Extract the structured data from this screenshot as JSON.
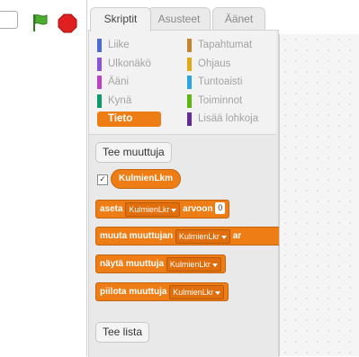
{
  "colors": {
    "motion": "#4a6cd4",
    "looks": "#8a55d7",
    "sound": "#bb42c3",
    "pen": "#0e9a6c",
    "data": "#ee7d16",
    "events": "#c88330",
    "control": "#e1a91a",
    "sensing": "#2ca5e2",
    "operators": "#5cb712",
    "more_blocks": "#632d99"
  },
  "stage": {
    "flag_icon": "green-flag-icon",
    "stop_icon": "stop-icon"
  },
  "tabs": [
    {
      "label": "Skriptit",
      "active": true
    },
    {
      "label": "Asusteet",
      "active": false
    },
    {
      "label": "Äänet",
      "active": false
    }
  ],
  "categories": [
    {
      "label": "Liike",
      "color": "#4a6cd4"
    },
    {
      "label": "Tapahtumat",
      "color": "#c88330"
    },
    {
      "label": "Ulkonäkö",
      "color": "#8a55d7"
    },
    {
      "label": "Ohjaus",
      "color": "#e1a91a"
    },
    {
      "label": "Ääni",
      "color": "#bb42c3"
    },
    {
      "label": "Tuntoaisti",
      "color": "#2ca5e2"
    },
    {
      "label": "Kynä",
      "color": "#0e9a6c"
    },
    {
      "label": "Toiminnot",
      "color": "#5cb712"
    },
    {
      "label": "Tieto",
      "color": "#ee7d16",
      "selected": true
    },
    {
      "label": "Lisää lohkoja",
      "color": "#632d99"
    }
  ],
  "palette": {
    "make_variable": "Tee muuttuja",
    "variable_checkbox": "✓",
    "variable_name": "KulmienLkm",
    "blocks": {
      "set": {
        "word1": "aseta",
        "var": "KulmienLkr",
        "word2": "arvoon",
        "value": "0"
      },
      "change": {
        "word1": "muuta muuttujan",
        "var": "KulmienLkr",
        "word2": "ar"
      },
      "show": {
        "word1": "näytä muuttuja",
        "var": "KulmienLkr"
      },
      "hide": {
        "word1": "piilota muuttuja",
        "var": "KulmienLkr"
      }
    },
    "make_list": "Tee lista"
  }
}
